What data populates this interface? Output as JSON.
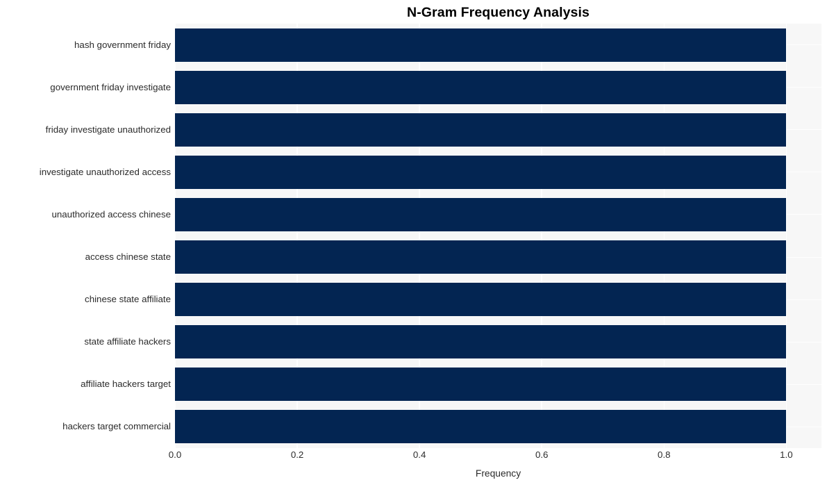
{
  "chart_data": {
    "type": "bar",
    "orientation": "horizontal",
    "title": "N-Gram Frequency Analysis",
    "xlabel": "Frequency",
    "ylabel": "",
    "categories": [
      "hash government friday",
      "government friday investigate",
      "friday investigate unauthorized",
      "investigate unauthorized access",
      "unauthorized access chinese",
      "access chinese state",
      "chinese state affiliate",
      "state affiliate hackers",
      "affiliate hackers target",
      "hackers target commercial"
    ],
    "values": [
      1.0,
      1.0,
      1.0,
      1.0,
      1.0,
      1.0,
      1.0,
      1.0,
      1.0,
      1.0
    ],
    "xlim": [
      0.0,
      1.0575
    ],
    "xticks": [
      0.0,
      0.2,
      0.4,
      0.6,
      0.8,
      1.0
    ],
    "xtick_labels": [
      "0.0",
      "0.2",
      "0.4",
      "0.6",
      "0.8",
      "1.0"
    ],
    "grid": true,
    "legend": null,
    "bar_color": "#032552",
    "plot_background": "#f7f7f7",
    "figure_background": "#ffffff",
    "gridline_color": "#ffffff",
    "tick_label_color": "#2b2b2b",
    "title_color": "#000000"
  }
}
